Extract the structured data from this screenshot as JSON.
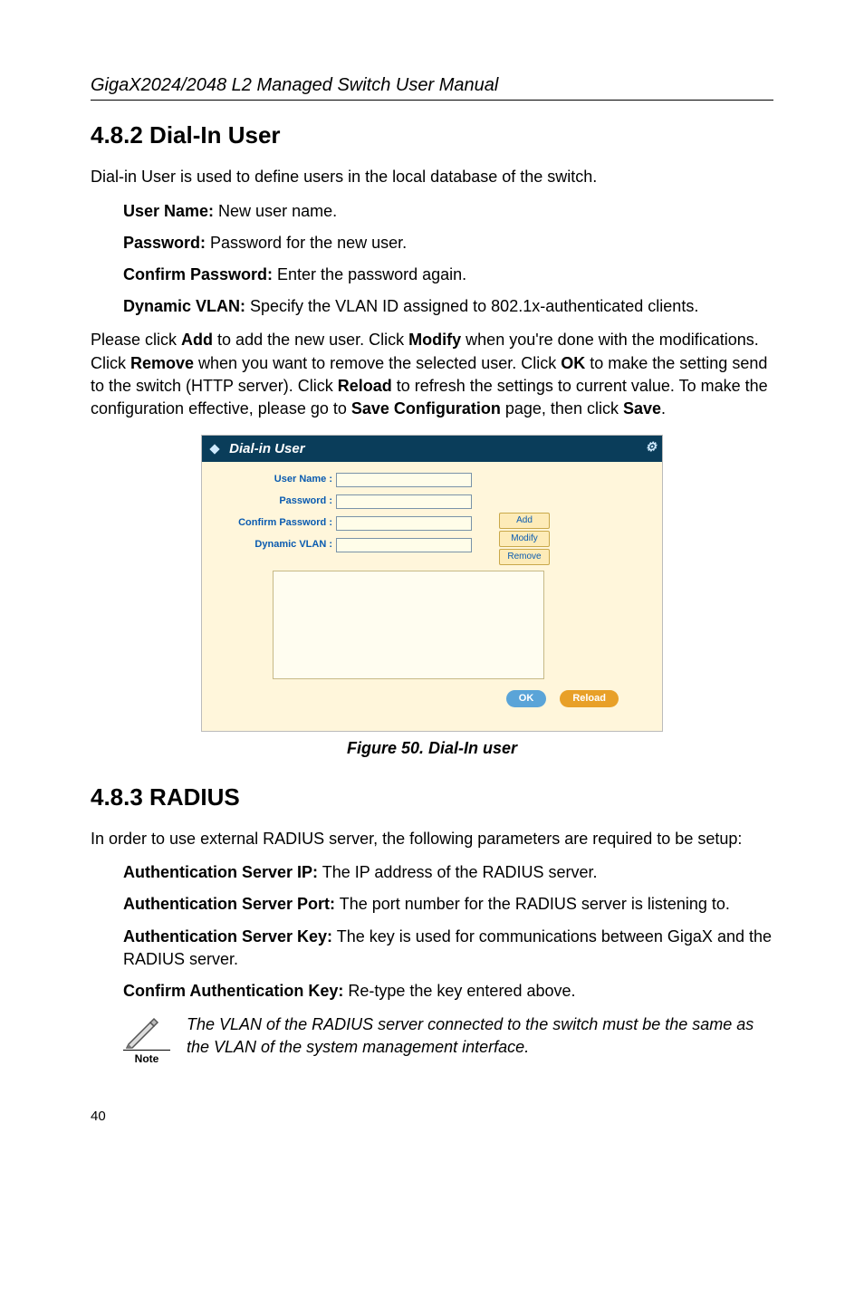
{
  "header": "GigaX2024/2048 L2 Managed Switch User Manual",
  "sec1": {
    "title": "4.8.2 Dial-In User",
    "intro": "Dial-in User is used to define users in the local database of the switch.",
    "items": [
      {
        "label": "User Name:",
        "desc": " New user name."
      },
      {
        "label": "Password:",
        "desc": " Password for the new user."
      },
      {
        "label": "Confirm Password:",
        "desc": " Enter the password again."
      },
      {
        "label": "Dynamic VLAN:",
        "desc": " Specify the VLAN ID assigned to 802.1x-authenticated clients."
      }
    ],
    "para_parts": [
      "Please click ",
      "Add",
      " to add the new user. Click ",
      "Modify",
      " when you're done with the modifications. Click ",
      "Remove",
      " when you want to remove the selected user. Click ",
      "OK",
      " to make the setting send to the switch (HTTP server). Click ",
      "Reload",
      " to refresh the settings to current value. To make the configuration effective, please go to ",
      "Save Configuration",
      " page, then click ",
      "Save",
      "."
    ]
  },
  "shot": {
    "title": "Dial-in User",
    "labels": {
      "user": "User Name :",
      "pass": "Password :",
      "cpass": "Confirm Password :",
      "dvlan": "Dynamic VLAN :"
    },
    "buttons": {
      "add": "Add",
      "modify": "Modify",
      "remove": "Remove"
    },
    "footer": {
      "ok": "OK",
      "reload": "Reload"
    }
  },
  "figure_caption": "Figure 50. Dial-In user",
  "sec2": {
    "title": "4.8.3 RADIUS",
    "intro": "In order to use external RADIUS server, the following parameters are required to be setup:",
    "items": [
      {
        "label": "Authentication Server IP:",
        "desc": " The IP address of the RADIUS server."
      },
      {
        "label": "Authentication Server Port:",
        "desc": " The port number for the RADIUS server is listening to."
      },
      {
        "label": "Authentication Server Key:",
        "desc": " The key is used for communications between GigaX and the RADIUS server."
      },
      {
        "label": "Confirm Authentication Key:",
        "desc": " Re-type the key entered above."
      }
    ]
  },
  "note": {
    "label": "Note",
    "text": "The VLAN of the RADIUS server connected  to the switch must be the same as the VLAN of the system management interface."
  },
  "page_number": "40"
}
